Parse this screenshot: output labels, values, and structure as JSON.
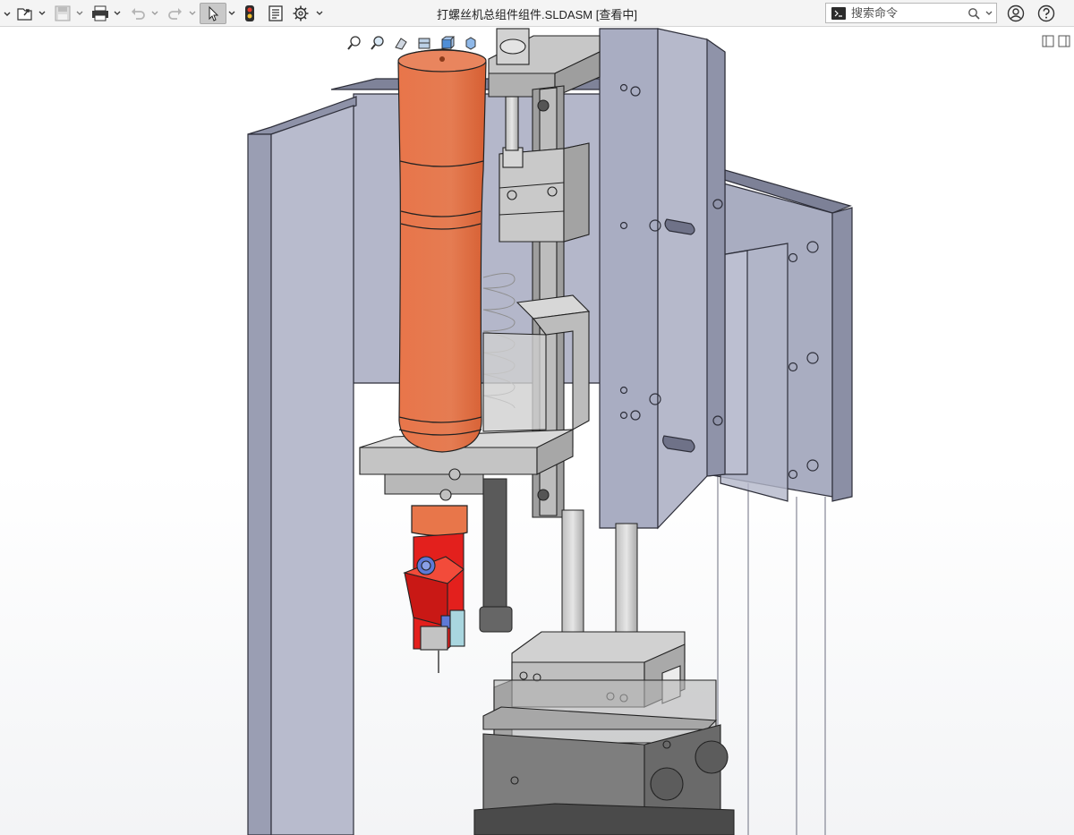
{
  "window": {
    "title": "打螺丝机总组件组件.SLDASM [查看中]"
  },
  "toolbar": {
    "items": [
      {
        "name": "new-document",
        "icon": "new-document-icon"
      },
      {
        "name": "open",
        "icon": "open-folder-icon"
      },
      {
        "name": "save",
        "icon": "save-icon"
      },
      {
        "name": "print",
        "icon": "print-icon"
      },
      {
        "name": "undo",
        "icon": "undo-icon"
      },
      {
        "name": "redo",
        "icon": "redo-icon"
      },
      {
        "name": "select",
        "icon": "cursor-icon"
      },
      {
        "name": "rebuild",
        "icon": "traffic-light-icon"
      },
      {
        "name": "file-properties",
        "icon": "file-properties-icon"
      },
      {
        "name": "options",
        "icon": "gear-icon"
      }
    ]
  },
  "search": {
    "placeholder": "搜索命令"
  },
  "heads_up_view": {
    "items": [
      "zoom-to-fit-icon",
      "zoom-to-area-icon",
      "previous-view-icon",
      "section-view-icon",
      "view-orientation-icon",
      "display-style-icon",
      "hide-show-icon",
      "edit-appearance-icon",
      "apply-scene-icon",
      "view-settings-icon"
    ]
  },
  "colors": {
    "frame": "#b9bccd",
    "frame_dark": "#8f93aa",
    "tool_body": "#e6764a",
    "red_part": "#e3201d",
    "metal": "#c4c4c4",
    "dark_metal": "#8a8a8a",
    "toolbar_bg": "#f4f4f4"
  }
}
